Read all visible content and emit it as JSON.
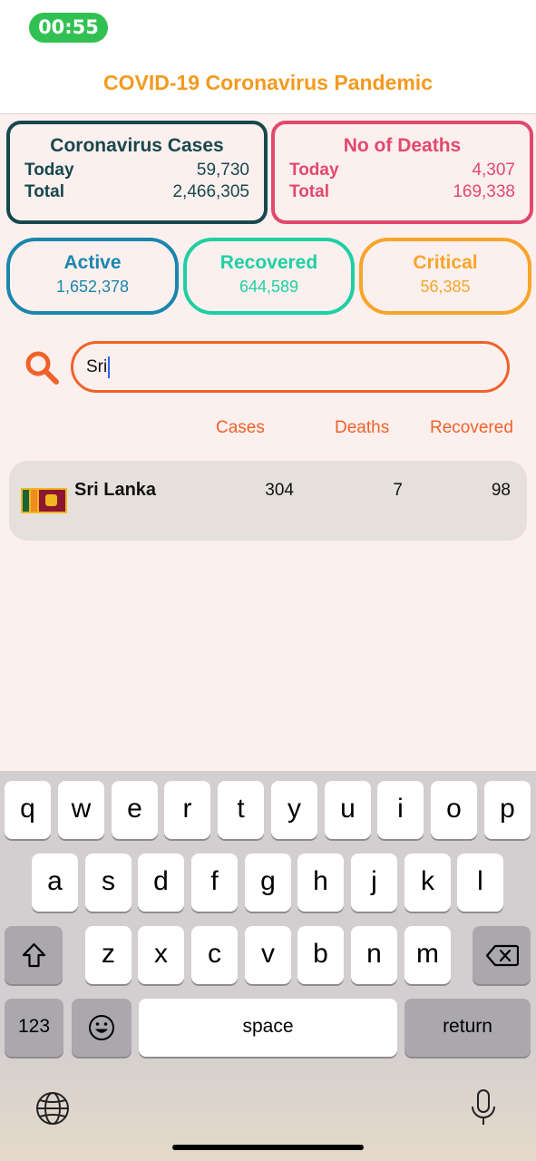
{
  "status_bar": {
    "time": "00:55"
  },
  "app": {
    "title": "COVID-19 Coronavirus Pandemic"
  },
  "colors": {
    "title": "#f39a1f",
    "cases": "#17474e",
    "deaths": "#e2486e",
    "active": "#1b86ad",
    "recovered": "#1fcfa3",
    "critical": "#f6a52b",
    "search_accent": "#f0622a"
  },
  "cases": {
    "title": "Coronavirus Cases",
    "today_label": "Today",
    "today_value": "59,730",
    "total_label": "Total",
    "total_value": "2,466,305"
  },
  "deaths": {
    "title": "No of Deaths",
    "today_label": "Today",
    "today_value": "4,307",
    "total_label": "Total",
    "total_value": "169,338"
  },
  "stats": {
    "active_label": "Active",
    "active_value": "1,652,378",
    "recovered_label": "Recovered",
    "recovered_value": "644,589",
    "critical_label": "Critical",
    "critical_value": "56,385"
  },
  "search": {
    "icon": "search-icon",
    "value": "Sri"
  },
  "table": {
    "headers": {
      "cases": "Cases",
      "deaths": "Deaths",
      "recovered": "Recovered"
    },
    "rows": [
      {
        "flag": "sri-lanka-flag",
        "country": "Sri Lanka",
        "cases": "304",
        "deaths": "7",
        "recovered": "98"
      }
    ]
  },
  "keyboard": {
    "row1": [
      "q",
      "w",
      "e",
      "r",
      "t",
      "y",
      "u",
      "i",
      "o",
      "p"
    ],
    "row2": [
      "a",
      "s",
      "d",
      "f",
      "g",
      "h",
      "j",
      "k",
      "l"
    ],
    "row3": [
      "z",
      "x",
      "c",
      "v",
      "b",
      "n",
      "m"
    ],
    "numbers_label": "123",
    "space_label": "space",
    "return_label": "return",
    "icons": [
      "shift-icon",
      "backspace-icon",
      "emoji-icon",
      "globe-icon",
      "microphone-icon"
    ]
  }
}
